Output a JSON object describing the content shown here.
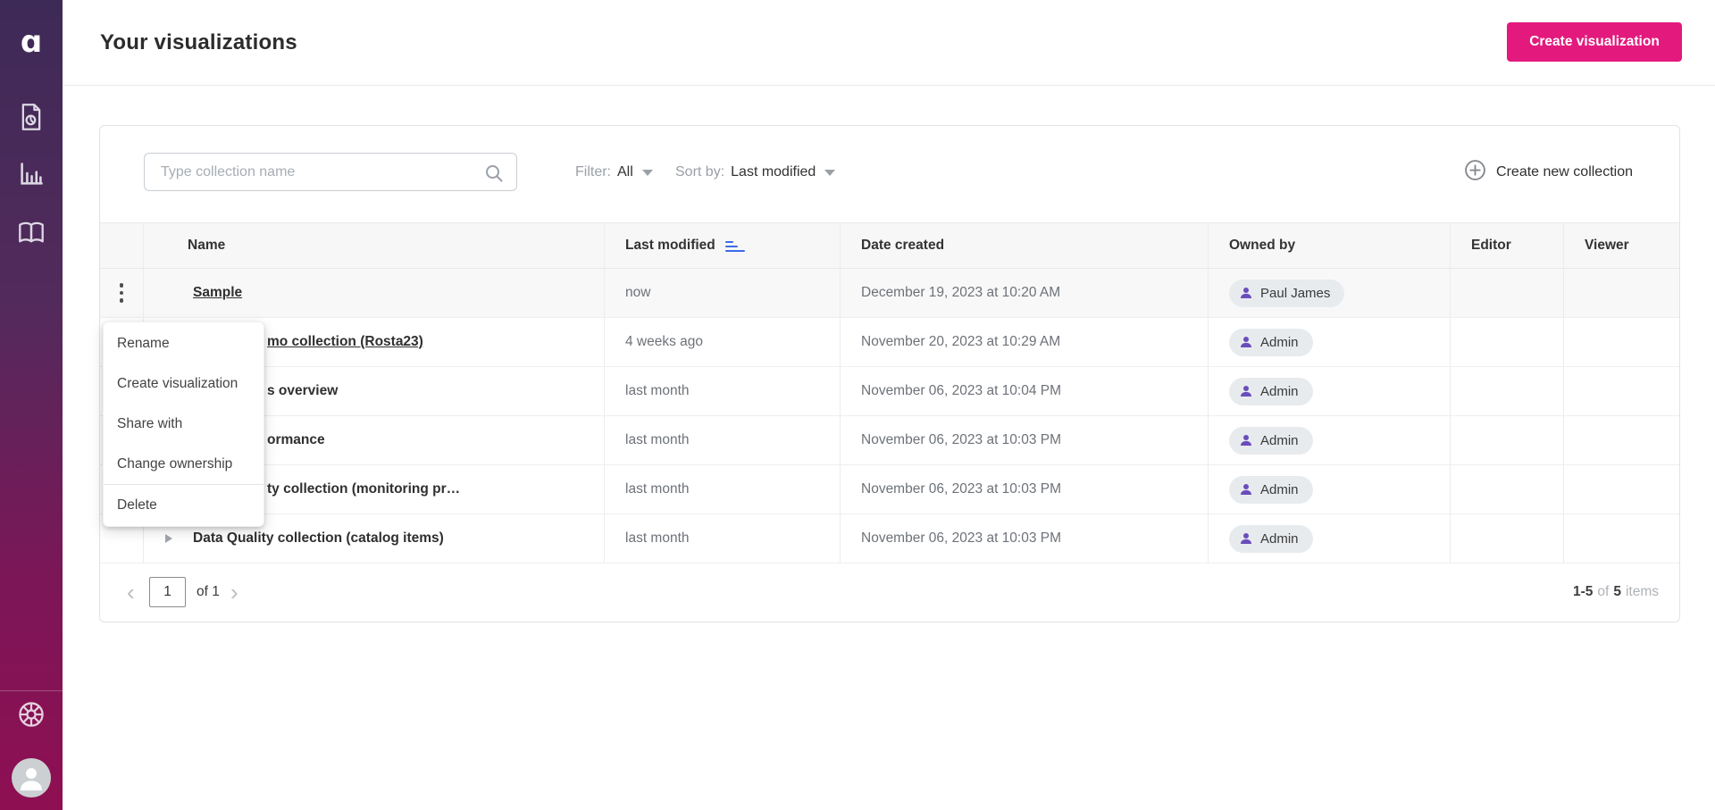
{
  "colors": {
    "accent_pink": "#e3197d",
    "icon_purple": "#6a4dbc",
    "sort_icon_blue": "#3b6ce8",
    "sidebar_gradient_top": "#3e2a57",
    "sidebar_gradient_bottom": "#8e0f52"
  },
  "sidebar": {
    "logo_glyph": "ɑ",
    "nav_icons": [
      "report-icon",
      "bar-chart-icon",
      "glossary-book-icon"
    ],
    "footer_icons": [
      "wheel-icon",
      "user-avatar"
    ]
  },
  "header": {
    "title": "Your visualizations",
    "create_button": "Create visualization"
  },
  "toolbar": {
    "search_placeholder": "Type collection name",
    "filter_label": "Filter:",
    "filter_value": "All",
    "sort_label": "Sort by:",
    "sort_value": "Last modified",
    "create_collection": "Create new collection"
  },
  "table": {
    "columns": [
      "Name",
      "Last modified",
      "Date created",
      "Owned by",
      "Editor",
      "Viewer"
    ],
    "rows": [
      {
        "name": "Sample",
        "modified": "now",
        "created": "December 19, 2023 at 10:20 AM",
        "owner": "Paul James"
      },
      {
        "name": "mo collection (Rosta23)",
        "modified": "4 weeks ago",
        "created": "November 20, 2023 at 10:29 AM",
        "owner": "Admin"
      },
      {
        "name": "s overview",
        "modified": "last month",
        "created": "November 06, 2023 at 10:04 PM",
        "owner": "Admin"
      },
      {
        "name": "ormance",
        "modified": "last month",
        "created": "November 06, 2023 at 10:03 PM",
        "owner": "Admin"
      },
      {
        "name": "ty collection (monitoring pr…",
        "modified": "last month",
        "created": "November 06, 2023 at 10:03 PM",
        "owner": "Admin"
      },
      {
        "name": "Data Quality collection (catalog items)",
        "modified": "last month",
        "created": "November 06, 2023 at 10:03 PM",
        "owner": "Admin"
      }
    ]
  },
  "context_menu": {
    "items": [
      "Rename",
      "Create visualization",
      "Share with",
      "Change ownership",
      "Delete"
    ]
  },
  "pagination": {
    "prev": "‹",
    "page": "1",
    "of_page": "of 1",
    "next": "›",
    "range": "1-5",
    "of_word": "of",
    "total": "5",
    "items_word": "items"
  }
}
